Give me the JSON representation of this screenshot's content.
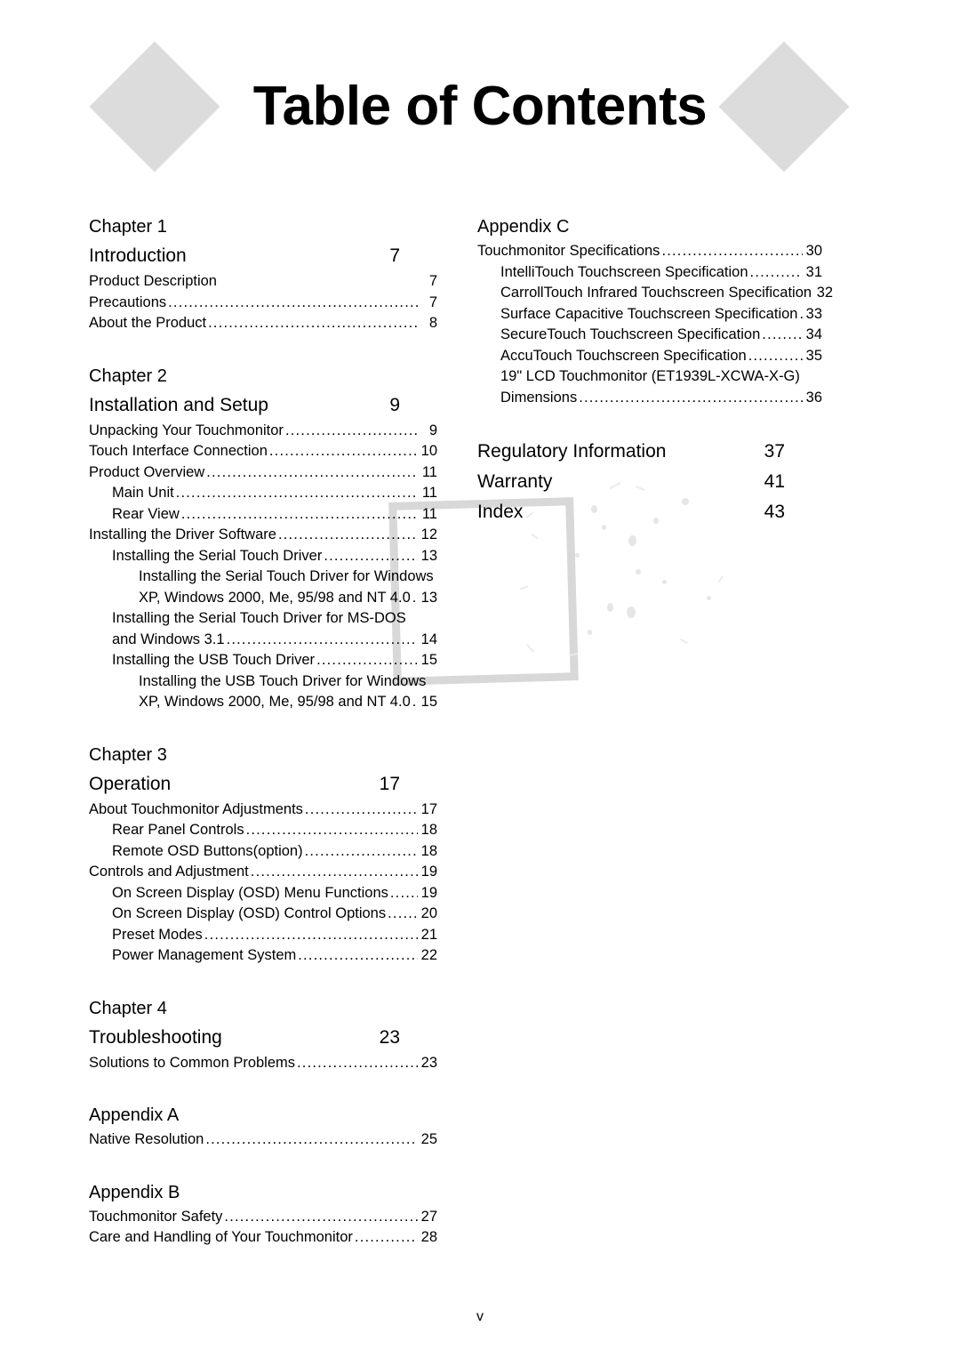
{
  "document": {
    "title": "Table of Contents",
    "folio": "v"
  },
  "colors": {
    "diamond": "#dcdcdc",
    "watermark": "#d8d8d8",
    "text": "#000000",
    "page_background": "#ffffff"
  },
  "toc": {
    "left_column": [
      {
        "chapter_label": "Chapter 1",
        "heading": "Introduction",
        "heading_page": "7",
        "entries": [
          {
            "level": 0,
            "text": "Product Description",
            "page": "7",
            "leader": false
          },
          {
            "level": 0,
            "text": "Precautions",
            "page": "7",
            "leader": true
          },
          {
            "level": 0,
            "text": "About the Product ",
            "page": "8",
            "leader": true
          }
        ]
      },
      {
        "chapter_label": "Chapter 2",
        "heading": "Installation and Setup",
        "heading_page": "9",
        "entries": [
          {
            "level": 0,
            "text": "Unpacking Your Touchmonitor",
            "page": "9",
            "leader": true
          },
          {
            "level": 0,
            "text": "Touch Interface Connection ",
            "page": "10",
            "leader": true
          },
          {
            "level": 0,
            "text": "Product Overview ",
            "page": "11",
            "leader": true
          },
          {
            "level": 1,
            "text": "Main Unit ",
            "page": "11",
            "leader": true
          },
          {
            "level": 1,
            "text": "Rear View ",
            "page": "11",
            "leader": true
          },
          {
            "level": 0,
            "text": "Installing the Driver Software ",
            "page": "12",
            "leader": true
          },
          {
            "level": 1,
            "text": "Installing the Serial Touch Driver ",
            "page": "13",
            "leader": true
          },
          {
            "level": 2,
            "text": "Installing the Serial Touch Driver for Windows",
            "page": "",
            "leader": false
          },
          {
            "level": 2,
            "text": "XP, Windows 2000, Me, 95/98 and NT 4.0 ",
            "page": "13",
            "leader": true
          },
          {
            "level": 1,
            "text": "Installing the Serial Touch Driver for MS-DOS",
            "page": "",
            "leader": false
          },
          {
            "level": 1,
            "text": "and Windows 3.1 ",
            "page": "14",
            "leader": true
          },
          {
            "level": 1,
            "text": "Installing the USB Touch Driver ",
            "page": "15",
            "leader": true
          },
          {
            "level": 2,
            "text": "Installing the USB Touch Driver for Windows",
            "page": "",
            "leader": false
          },
          {
            "level": 2,
            "text": "XP, Windows 2000, Me, 95/98 and NT 4.0 ",
            "page": "15",
            "leader": true
          }
        ]
      },
      {
        "chapter_label": "Chapter 3",
        "heading": "Operation",
        "heading_page": "17",
        "entries": [
          {
            "level": 0,
            "text": "About Touchmonitor Adjustments ",
            "page": "17",
            "leader": true
          },
          {
            "level": 1,
            "text": "Rear Panel Controls ",
            "page": "18",
            "leader": true
          },
          {
            "level": 1,
            "text": "Remote OSD Buttons(option) ",
            "page": "18",
            "leader": true
          },
          {
            "level": 0,
            "text": "Controls and Adjustment ",
            "page": "19",
            "leader": true
          },
          {
            "level": 1,
            "text": "On Screen Display (OSD) Menu Functions ",
            "page": "19",
            "leader": true
          },
          {
            "level": 1,
            "text": "On Screen Display (OSD) Control Options ",
            "page": "20",
            "leader": true
          },
          {
            "level": 1,
            "text": "Preset Modes ",
            "page": "21",
            "leader": true
          },
          {
            "level": 1,
            "text": "Power Management System ",
            "page": "22",
            "leader": true
          }
        ]
      },
      {
        "chapter_label": "Chapter 4",
        "heading": "Troubleshooting",
        "heading_page": "23",
        "entries": [
          {
            "level": 0,
            "text": "Solutions to Common Problems ",
            "page": "23",
            "leader": true
          }
        ]
      },
      {
        "chapter_label": "Appendix A",
        "heading": "",
        "heading_page": "",
        "entries": [
          {
            "level": 0,
            "text": "Native Resolution ",
            "page": "25",
            "leader": true
          }
        ]
      },
      {
        "chapter_label": "Appendix B",
        "heading": "",
        "heading_page": "",
        "entries": [
          {
            "level": 0,
            "text": "Touchmonitor Safety ",
            "page": "27",
            "leader": true
          },
          {
            "level": 0,
            "text": "Care and Handling of Your Touchmonitor ",
            "page": "28",
            "leader": true
          }
        ]
      }
    ],
    "right_column": [
      {
        "chapter_label": "Appendix C",
        "heading": "",
        "heading_page": "",
        "entries": [
          {
            "level": 0,
            "text": "Touchmonitor Specifications ",
            "page": "30",
            "leader": true
          },
          {
            "level": 1,
            "text": "IntelliTouch Touchscreen Specification",
            "page": "31",
            "leader": true
          },
          {
            "level": 1,
            "text": "CarrollTouch Infrared Touchscreen Specification ",
            "page": "32",
            "leader": false
          },
          {
            "level": 1,
            "text": "Surface Capacitive Touchscreen Specification ",
            "page": "33",
            "leader": true
          },
          {
            "level": 1,
            "text": "SecureTouch Touchscreen Specification ",
            "page": "34",
            "leader": true
          },
          {
            "level": 1,
            "text": "AccuTouch Touchscreen Specification ",
            "page": "35",
            "leader": true
          },
          {
            "level": 1,
            "text": "19\" LCD Touchmonitor (ET1939L-XCWA-X-G)",
            "page": "",
            "leader": false
          },
          {
            "level": 1,
            "text": "Dimensions ",
            "page": "36",
            "leader": true
          }
        ]
      },
      {
        "chapter_label": "",
        "heading": "Regulatory Information",
        "heading_page": "37",
        "entries": []
      },
      {
        "chapter_label": "",
        "heading": "Warranty",
        "heading_page": "41",
        "entries": [],
        "tight": true
      },
      {
        "chapter_label": "",
        "heading": "Index",
        "heading_page": "43",
        "entries": [],
        "tight": true
      }
    ]
  }
}
